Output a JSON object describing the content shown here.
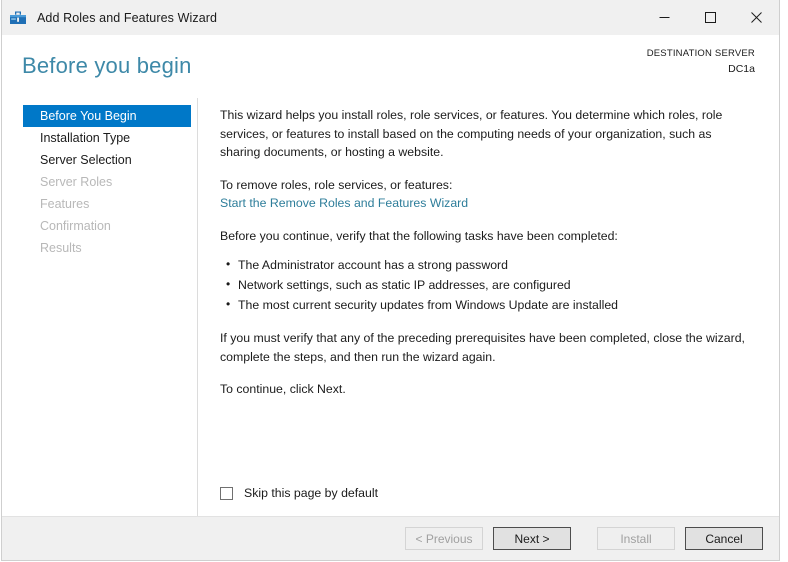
{
  "window": {
    "title": "Add Roles and Features Wizard",
    "icon": "server-manager-icon",
    "controls": {
      "minimize": "minimize-icon",
      "maximize": "maximize-icon",
      "close": "close-icon"
    }
  },
  "header": {
    "page_title": "Before you begin",
    "destination_label": "DESTINATION SERVER",
    "destination_name": "DC1a"
  },
  "sidebar": {
    "items": [
      {
        "label": "Before You Begin",
        "state": "active"
      },
      {
        "label": "Installation Type",
        "state": "enabled"
      },
      {
        "label": "Server Selection",
        "state": "enabled"
      },
      {
        "label": "Server Roles",
        "state": "disabled"
      },
      {
        "label": "Features",
        "state": "disabled"
      },
      {
        "label": "Confirmation",
        "state": "disabled"
      },
      {
        "label": "Results",
        "state": "disabled"
      }
    ]
  },
  "content": {
    "intro_paragraph": "This wizard helps you install roles, role services, or features. You determine which roles, role services, or features to install based on the computing needs of your organization, such as sharing documents, or hosting a website.",
    "remove_intro": "To remove roles, role services, or features:",
    "remove_link": "Start the Remove Roles and Features Wizard",
    "verify_intro": "Before you continue, verify that the following tasks have been completed:",
    "bullets": [
      "The Administrator account has a strong password",
      "Network settings, such as static IP addresses, are configured",
      "The most current security updates from Windows Update are installed"
    ],
    "prereq_paragraph": "If you must verify that any of the preceding prerequisites have been completed, close the wizard, complete the steps, and then run the wizard again.",
    "continue_paragraph": "To continue, click Next.",
    "skip_checkbox_label": "Skip this page by default",
    "skip_checkbox_checked": false
  },
  "footer": {
    "buttons": [
      {
        "label": "< Previous",
        "state": "disabled"
      },
      {
        "label": "Next >",
        "state": "default"
      },
      {
        "label": "Install",
        "state": "disabled"
      },
      {
        "label": "Cancel",
        "state": "enabled"
      }
    ]
  },
  "colors": {
    "accent_blue": "#0078c8",
    "title_blue": "#3e89a8",
    "link_blue": "#2d7d9a",
    "chrome_gray": "#f0f0f0",
    "background_window_red": "#9c2b2b"
  }
}
